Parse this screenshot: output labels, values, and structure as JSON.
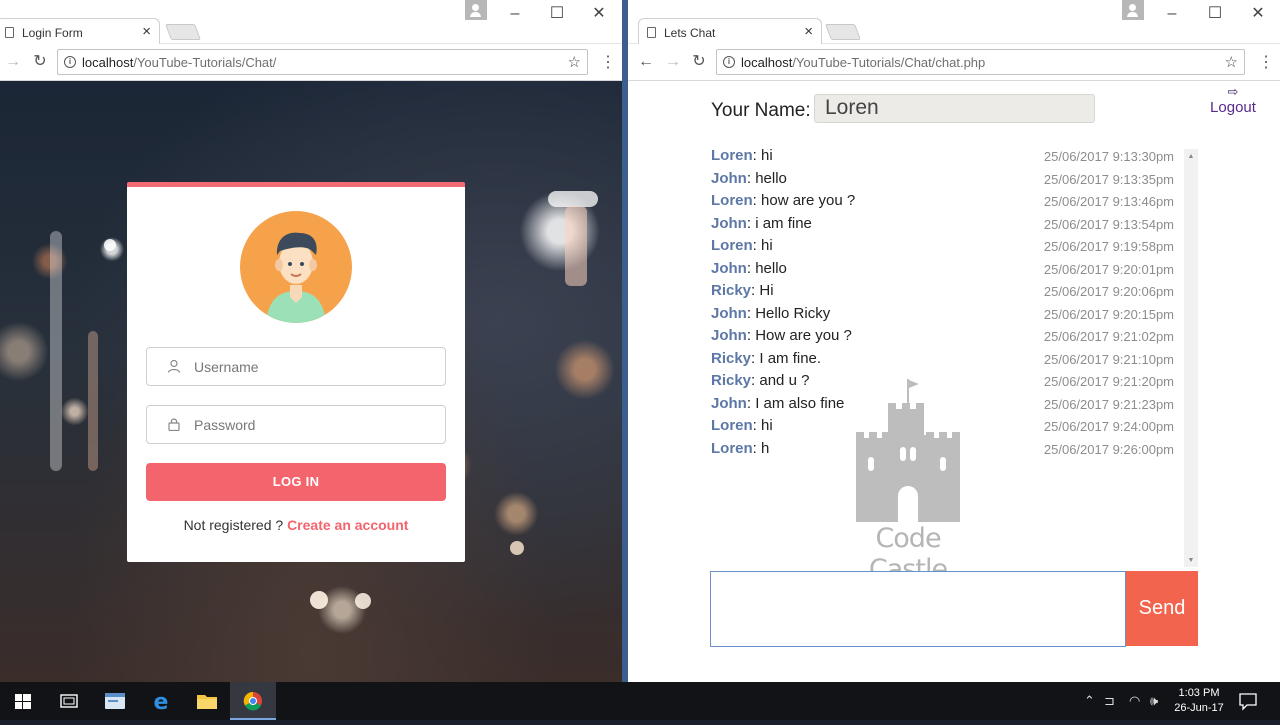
{
  "left_window": {
    "tab_title": "Login Form",
    "url_host": "localhost",
    "url_path": "/YouTube-Tutorials/Chat/",
    "form": {
      "username_placeholder": "Username",
      "password_placeholder": "Password",
      "login_label": "LOG IN",
      "not_registered": "Not registered ?",
      "create_account": "Create an account"
    }
  },
  "right_window": {
    "tab_title": "Lets Chat",
    "url_host": "localhost",
    "url_path": "/YouTube-Tutorials/Chat/chat.php",
    "your_name_label": "Your Name:",
    "your_name_value": "Loren",
    "logout_label": "Logout",
    "send_label": "Send",
    "watermark_text": "Code Castle",
    "messages": [
      {
        "user": "Loren",
        "text": "hi",
        "time": "25/06/2017 9:13:30pm"
      },
      {
        "user": "John",
        "text": "hello",
        "time": "25/06/2017 9:13:35pm"
      },
      {
        "user": "Loren",
        "text": "how are you ?",
        "time": "25/06/2017 9:13:46pm"
      },
      {
        "user": "John",
        "text": "i am fine",
        "time": "25/06/2017 9:13:54pm"
      },
      {
        "user": "Loren",
        "text": "hi",
        "time": "25/06/2017 9:19:58pm"
      },
      {
        "user": "John",
        "text": "hello",
        "time": "25/06/2017 9:20:01pm"
      },
      {
        "user": "Ricky",
        "text": "Hi",
        "time": "25/06/2017 9:20:06pm"
      },
      {
        "user": "John",
        "text": "Hello Ricky",
        "time": "25/06/2017 9:20:15pm"
      },
      {
        "user": "John",
        "text": "How are you ?",
        "time": "25/06/2017 9:21:02pm"
      },
      {
        "user": "Ricky",
        "text": "I am fine.",
        "time": "25/06/2017 9:21:10pm"
      },
      {
        "user": "Ricky",
        "text": "and u ?",
        "time": "25/06/2017 9:21:20pm"
      },
      {
        "user": "John",
        "text": "I am also fine",
        "time": "25/06/2017 9:21:23pm"
      },
      {
        "user": "Loren",
        "text": "hi",
        "time": "25/06/2017 9:24:00pm"
      },
      {
        "user": "Loren",
        "text": "h",
        "time": "25/06/2017 9:26:00pm"
      }
    ]
  },
  "taskbar": {
    "clock_time": "1:03 PM",
    "clock_date": "26-Jun-17"
  },
  "colors": {
    "accent": "#f3646d",
    "send": "#f2644d",
    "username_color": "#5d78a6",
    "logout": "#5a2a8a"
  }
}
